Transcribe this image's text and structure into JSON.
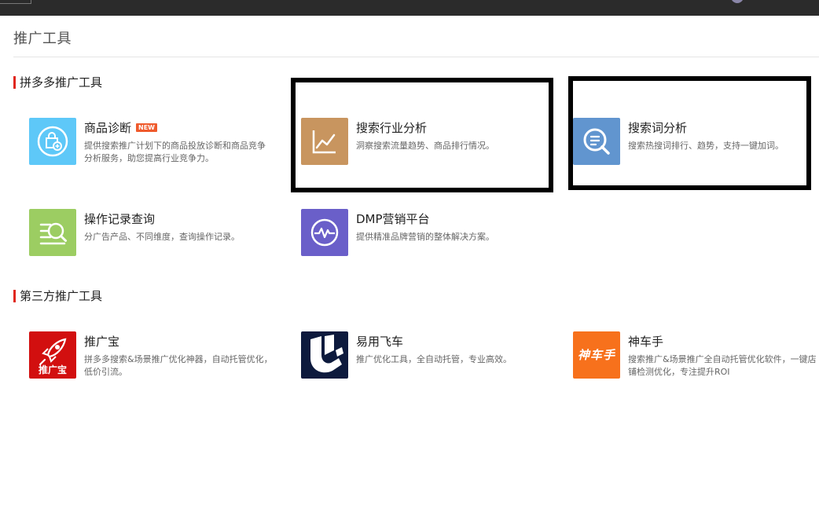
{
  "page": {
    "title": "推广工具"
  },
  "sections": {
    "pdd": {
      "title": "拼多多推广工具"
    },
    "third": {
      "title": "第三方推广工具"
    }
  },
  "tools": {
    "goods_diagnosis": {
      "name": "商品诊断",
      "badge": "NEW",
      "desc": "提供搜索推广计划下的商品投放诊断和商品竞争分析服务，助您提高行业竞争力。",
      "icon": "shopping-bag-plus-icon",
      "color": "#5ec8f8"
    },
    "industry_analysis": {
      "name": "搜索行业分析",
      "desc": "洞察搜索流量趋势、商品排行情况。",
      "icon": "line-chart-icon",
      "color": "#c8955f"
    },
    "keyword_analysis": {
      "name": "搜索词分析",
      "desc": "搜索热搜词排行、趋势，支持一键加词。",
      "icon": "search-list-icon",
      "color": "#6195cf"
    },
    "operation_log": {
      "name": "操作记录查询",
      "desc": "分广告产品、不同维度，查询操作记录。",
      "icon": "search-log-icon",
      "color": "#9ccd62"
    },
    "dmp": {
      "name": "DMP营销平台",
      "desc": "提供精准品牌营销的整体解决方案。",
      "icon": "pulse-icon",
      "color": "#6a5fc9"
    },
    "tuiguangbao": {
      "name": "推广宝",
      "desc": "拼多多搜索&场景推广优化神器，自动托管优化，低价引流。",
      "logo_text": "推广宝",
      "icon": "rocket-icon",
      "color": "#d20f0f"
    },
    "yiyong": {
      "name": "易用飞车",
      "desc": "推广优化工具，全自动托管，专业高效。",
      "icon": "yiyong-logo-icon",
      "color": "#0d1a3d"
    },
    "shencheshou": {
      "name": "神车手",
      "desc": "搜索推广&场景推广全自动托管优化软件，一键店铺检测优化，专注提升ROI",
      "logo_text": "神车手",
      "icon": "shencheshou-logo-icon",
      "color": "#f7711c"
    }
  }
}
